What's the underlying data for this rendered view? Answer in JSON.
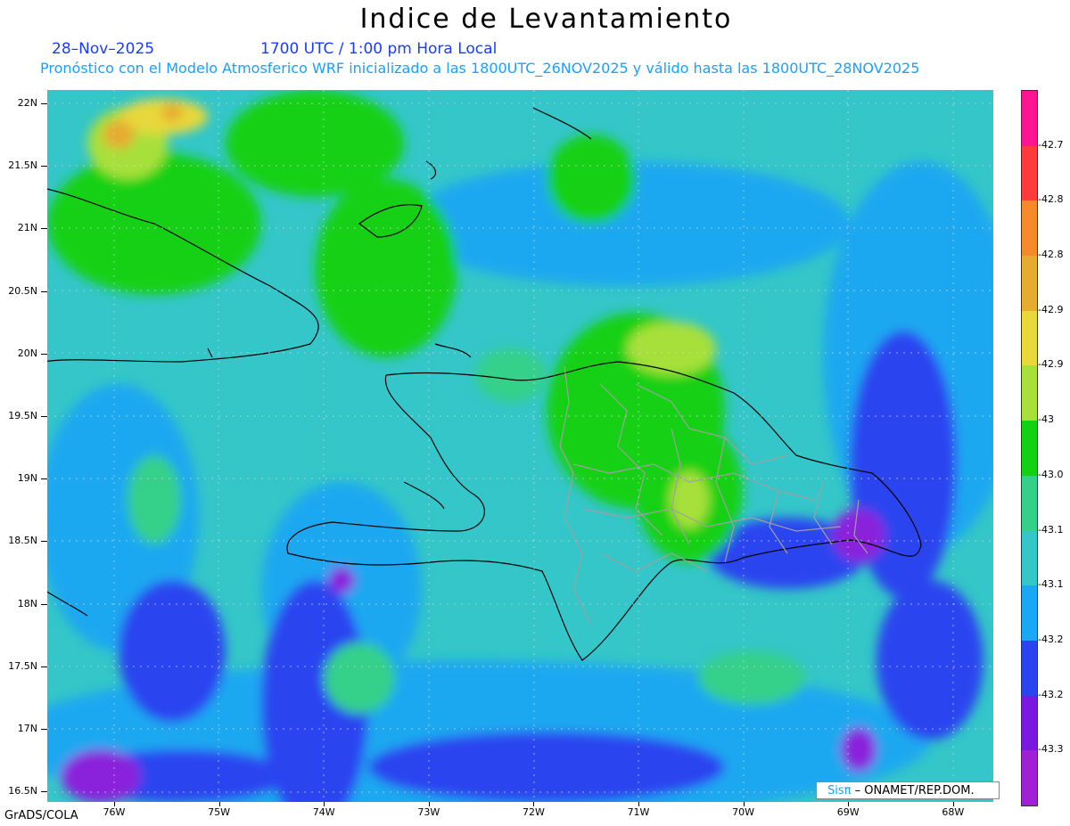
{
  "header": {
    "title": "Indice de Levantamiento",
    "date": "28–Nov–2025",
    "time": "1700 UTC / 1:00 pm Hora Local",
    "description": "Pronóstico con el Modelo Atmosferico WRF inicializado a las 1800UTC_26NOV2025 y válido hasta las  1800UTC_28NOV2025"
  },
  "axes": {
    "lat_labels": [
      "22N",
      "21.5N",
      "21N",
      "20.5N",
      "20N",
      "19.5N",
      "19N",
      "18.5N",
      "18N",
      "17.5N",
      "17N",
      "16.5N"
    ],
    "lon_labels": [
      "76W",
      "75W",
      "74W",
      "73W",
      "72W",
      "71W",
      "70W",
      "69W",
      "68W"
    ]
  },
  "colorbar": {
    "labels": [
      "-42.7",
      "-42.8",
      "-42.8",
      "-42.9",
      "-42.9",
      "-43",
      "-43.0",
      "-43.1",
      "-43.1",
      "-43.2",
      "-43.2",
      "-43.3"
    ],
    "colors": [
      "#ff1493",
      "#ff3a3a",
      "#f58a2a",
      "#e6ac30",
      "#e8d83a",
      "#a8e03a",
      "#12d012",
      "#34d08a",
      "#34c6c8",
      "#18a8f5",
      "#2a44f0",
      "#7a18e0",
      "#a020d8"
    ]
  },
  "footer": {
    "credit": "GrADS/COLA",
    "logo_sis": "Sisπ",
    "logo_rest": "– ONAMET/REP.DOM."
  },
  "palette": {
    "ocean_base": "#34c6c8",
    "coastline": "#000000",
    "province_lines": "#a0a0a0"
  }
}
